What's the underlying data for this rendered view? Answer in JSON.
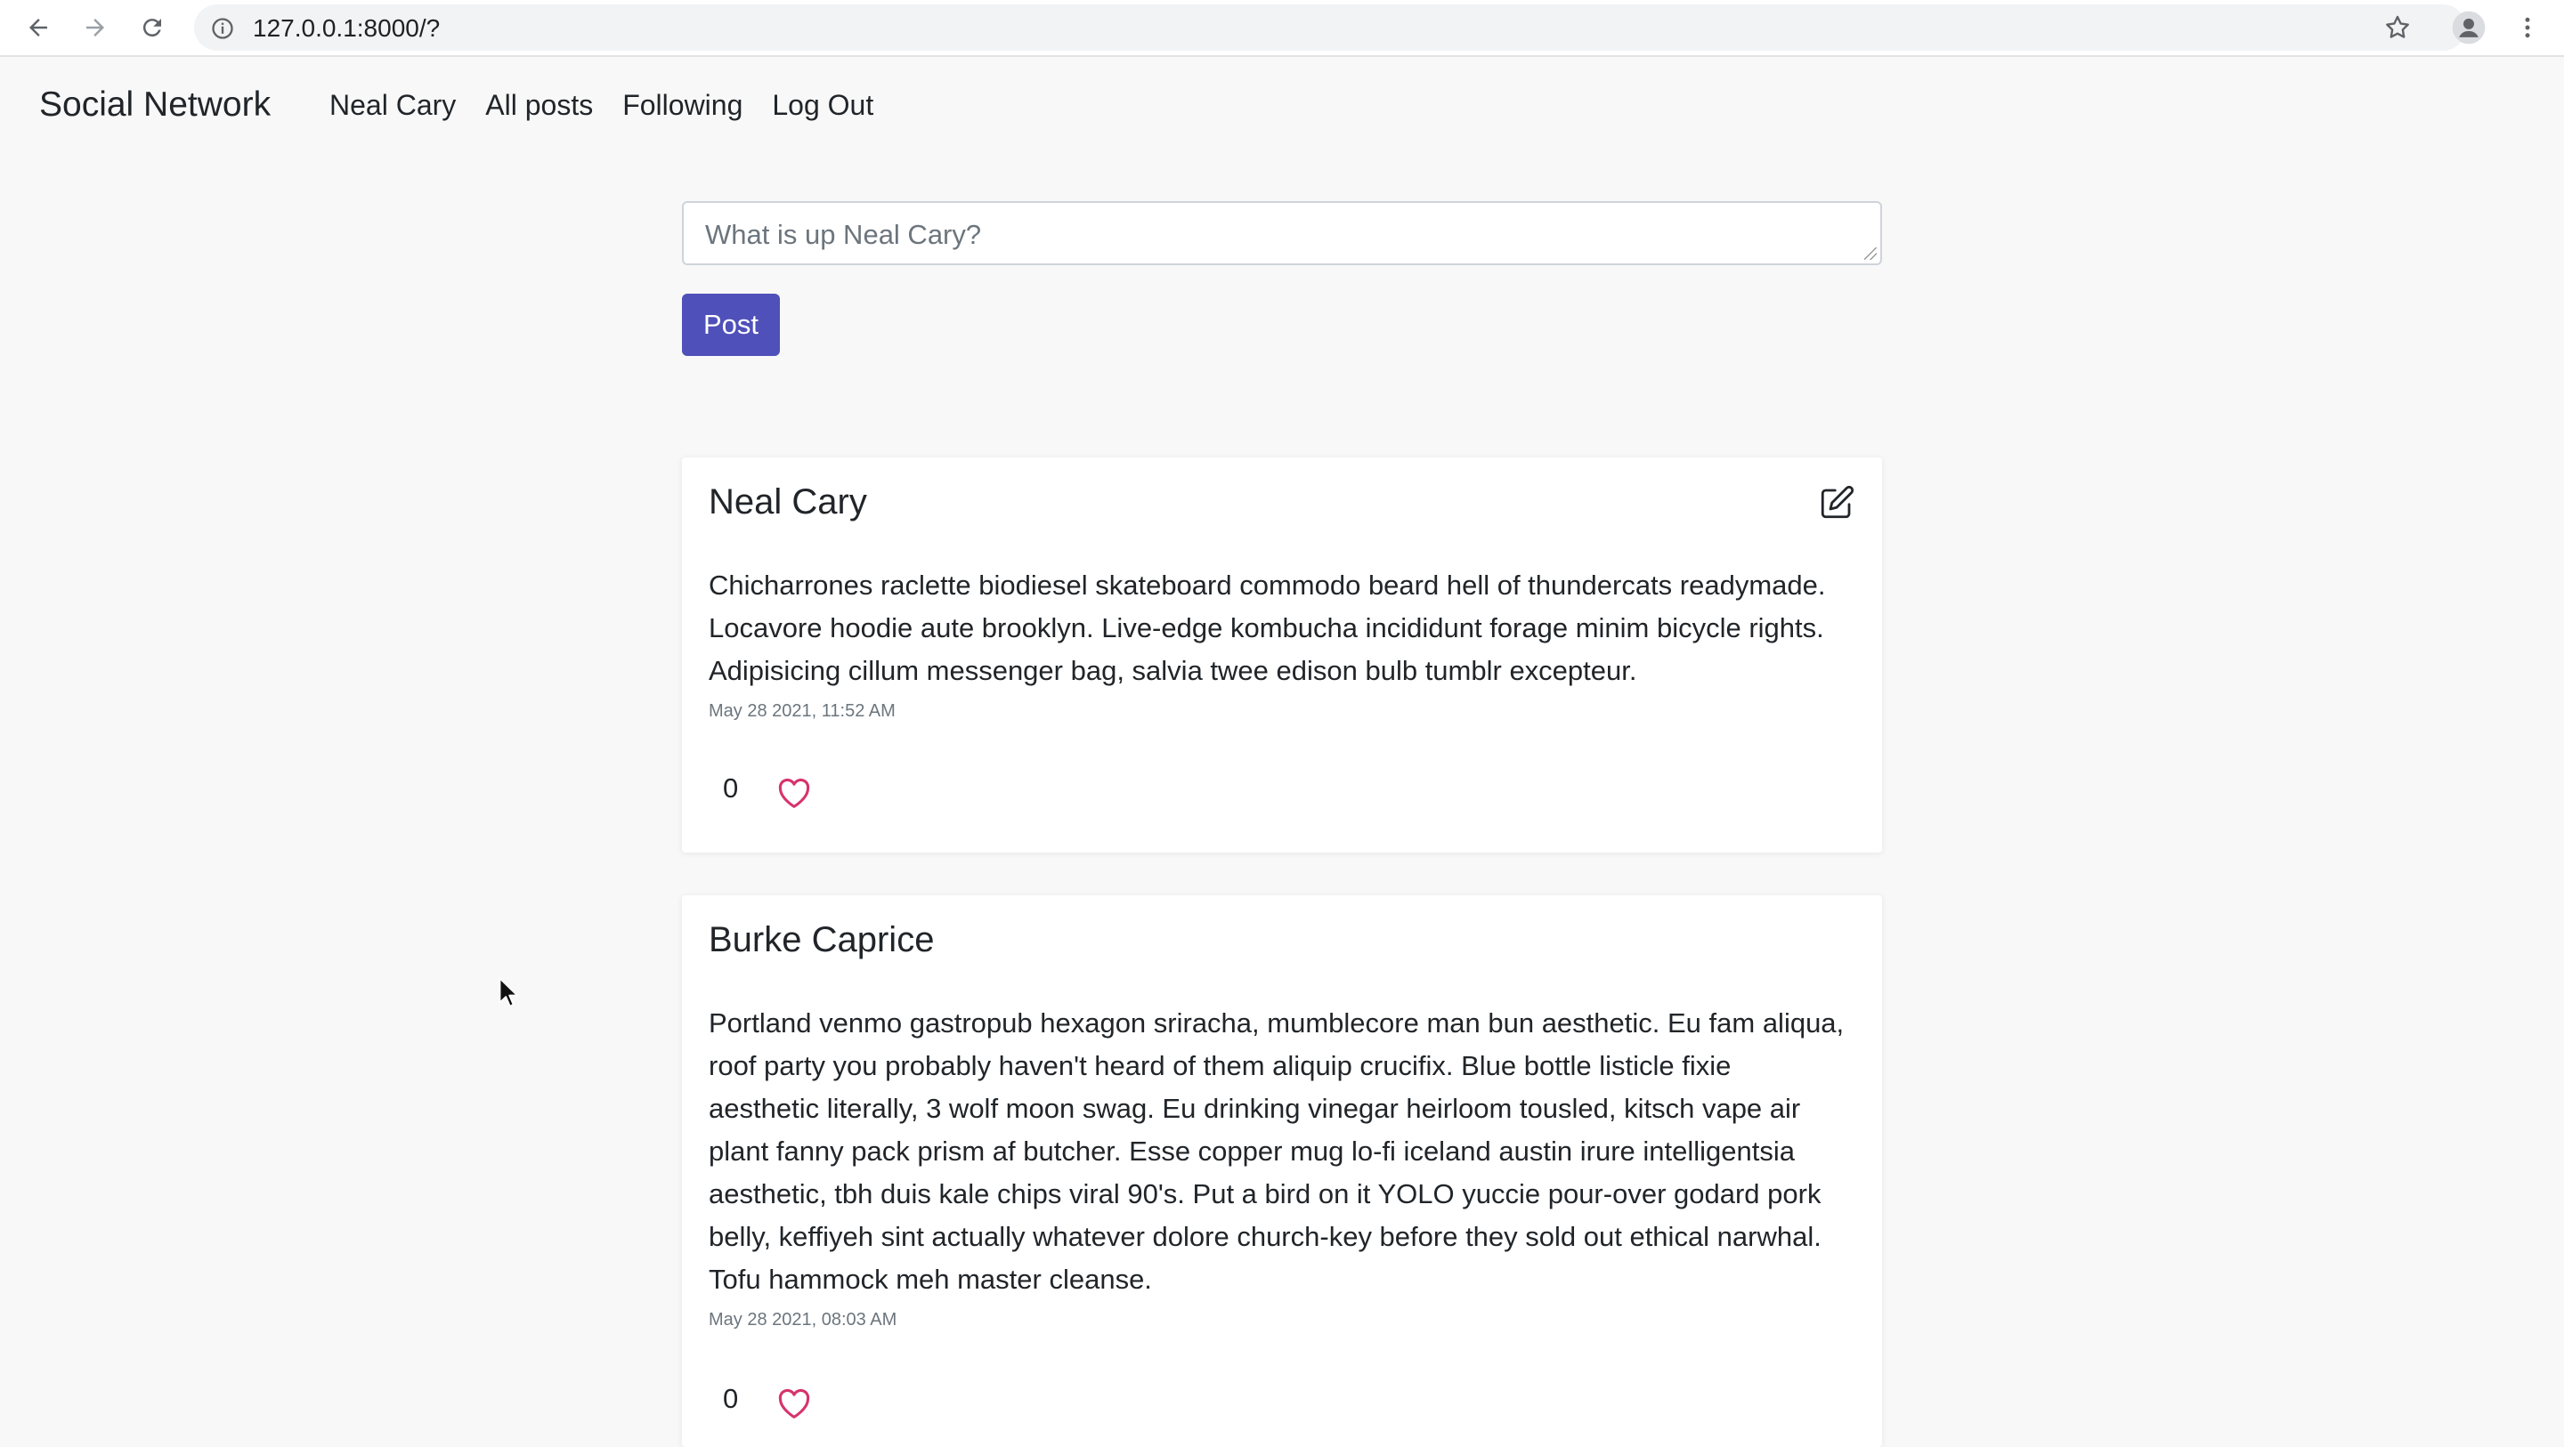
{
  "browser": {
    "url": "127.0.0.1:8000/?",
    "icons": [
      "back-icon",
      "forward-icon",
      "reload-icon",
      "info-icon",
      "star-icon",
      "profile-icon",
      "menu-icon"
    ]
  },
  "navbar": {
    "brand": "Social Network",
    "links": [
      "Neal Cary",
      "All posts",
      "Following",
      "Log Out"
    ]
  },
  "compose": {
    "placeholder": "What is up Neal Cary?",
    "button_label": "Post"
  },
  "posts": [
    {
      "author": "Neal Cary",
      "body": "Chicharrones raclette biodiesel skateboard commodo beard hell of thundercats readymade. Locavore hoodie aute brooklyn. Live-edge kombucha incididunt forage minim bicycle rights. Adipisicing cillum messenger bag, salvia twee edison bulb tumblr excepteur.",
      "timestamp": "May 28 2021, 11:52 AM",
      "likes": "0",
      "editable": true
    },
    {
      "author": "Burke Caprice",
      "body": "Portland venmo gastropub hexagon sriracha, mumblecore man bun aesthetic. Eu fam aliqua, roof party you probably haven't heard of them aliquip crucifix. Blue bottle listicle fixie aesthetic literally, 3 wolf moon swag. Eu drinking vinegar heirloom tousled, kitsch vape air plant fanny pack prism af butcher. Esse copper mug lo-fi iceland austin irure intelligentsia aesthetic, tbh duis kale chips viral 90's. Put a bird on it YOLO yuccie pour-over godard pork belly, keffiyeh sint actually whatever dolore church-key before they sold out ethical narwhal. Tofu hammock meh master cleanse.",
      "timestamp": "May 28 2021, 08:03 AM",
      "likes": "0",
      "editable": false
    }
  ],
  "colors": {
    "accent": "#4f50b9",
    "heart": "#d6336c",
    "background": "#f8f8f8"
  }
}
